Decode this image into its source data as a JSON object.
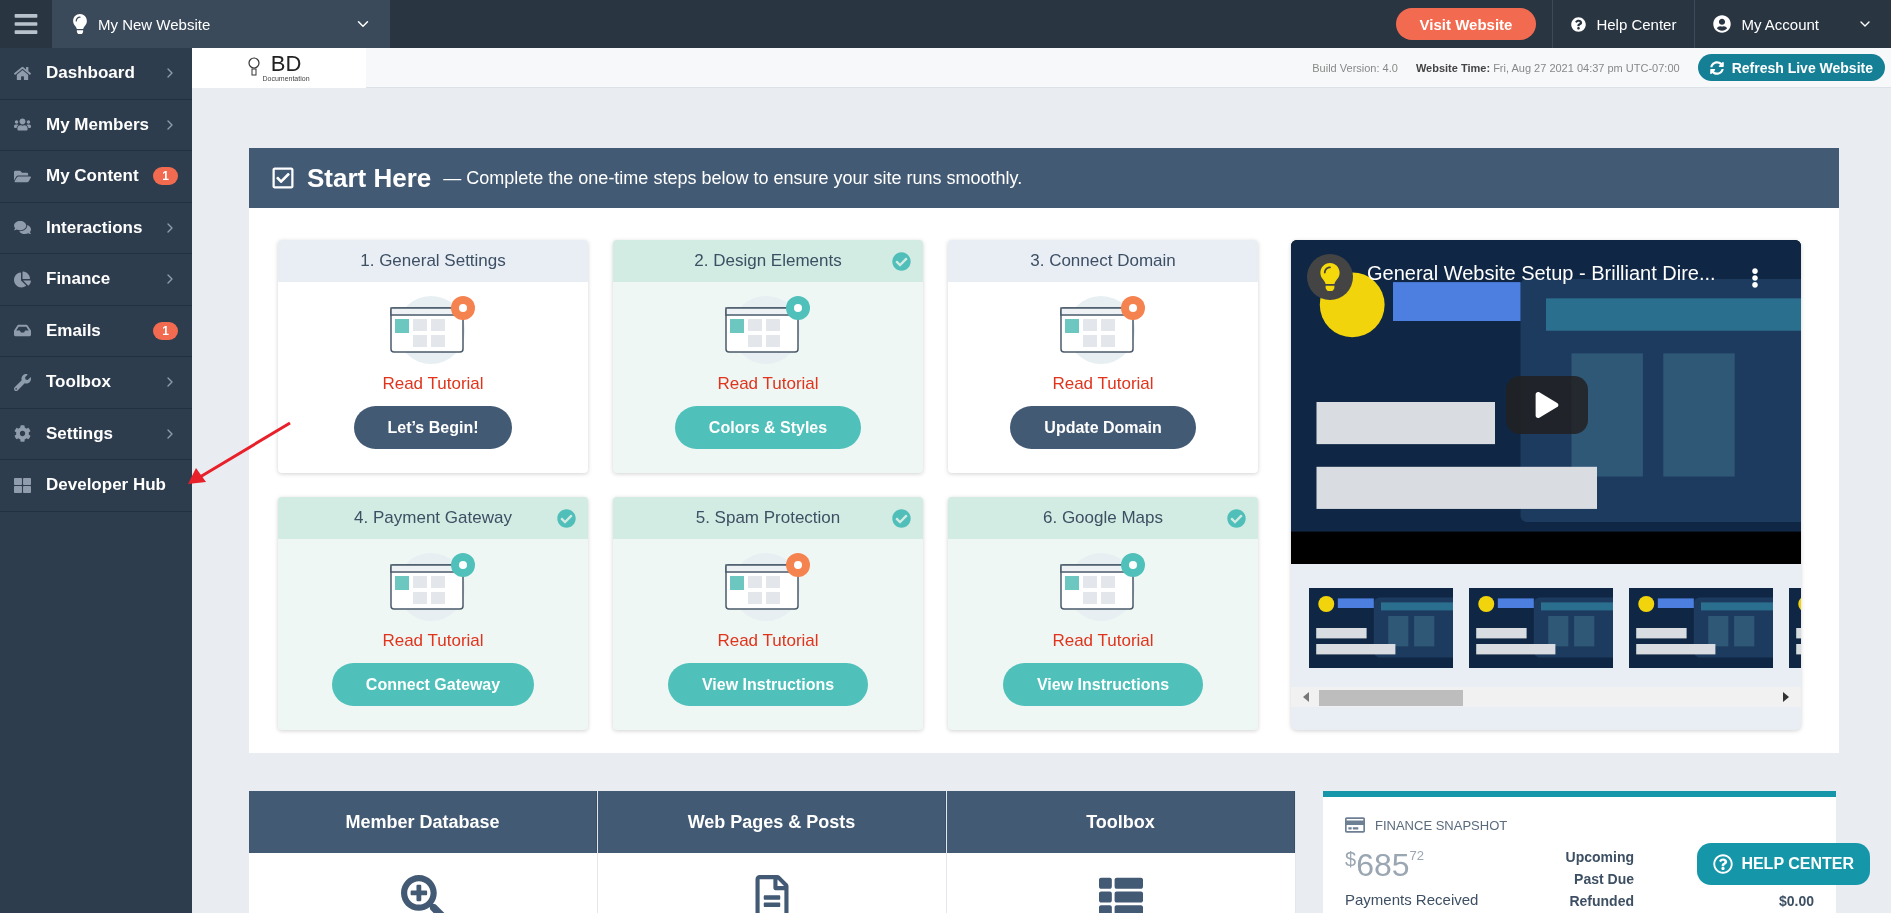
{
  "topbar": {
    "site": "My New Website",
    "visit_button": "Visit Website",
    "help": "Help Center",
    "account": "My Account"
  },
  "sidebar": {
    "items": [
      {
        "label": "Dashboard"
      },
      {
        "label": "My Members"
      },
      {
        "label": "My Content",
        "badge": "1"
      },
      {
        "label": "Interactions"
      },
      {
        "label": "Finance"
      },
      {
        "label": "Emails",
        "badge": "1"
      },
      {
        "label": "Toolbox"
      },
      {
        "label": "Settings"
      },
      {
        "label": "Developer Hub"
      }
    ]
  },
  "subheader": {
    "logo_mark": "BD",
    "logo_caption": "Documentation",
    "build": "Build Version: 4.0",
    "time": "**Website Time:** Fri, Aug 27 2021 04:37 pm UTC-07:00",
    "refresh_button": "Refresh Live Website"
  },
  "start_here": {
    "title": "Start Here",
    "subtitle": "— Complete the one-time steps below to ensure your site runs smoothly.",
    "steps": [
      {
        "title": "1. General Settings",
        "link": "Read Tutorial",
        "button": "Let’s Begin!",
        "done": false
      },
      {
        "title": "2. Design Elements",
        "link": "Read Tutorial",
        "button": "Colors & Styles",
        "done": true
      },
      {
        "title": "3. Connect Domain",
        "link": "Read Tutorial",
        "button": "Update Domain",
        "done": false
      },
      {
        "title": "4. Payment Gateway",
        "link": "Read Tutorial",
        "button": "Connect Gateway",
        "done": true
      },
      {
        "title": "5. Spam Protection",
        "link": "Read Tutorial",
        "button": "View Instructions",
        "done": true
      },
      {
        "title": "6. Google Maps",
        "link": "Read Tutorial",
        "button": "View Instructions",
        "done": true
      }
    ],
    "video": {
      "title": "General Website Setup - Brilliant Dire..."
    }
  },
  "tools": [
    {
      "label": "Member Database"
    },
    {
      "label": "Web Pages & Posts"
    },
    {
      "label": "Toolbox"
    }
  ],
  "finance": {
    "title": "FINANCE SNAPSHOT",
    "currency": "$",
    "amount": "685",
    "cents": "72",
    "amount_label": "Payments Received",
    "rows": [
      {
        "label": "Upcoming"
      },
      {
        "label": "Past Due"
      },
      {
        "label": "Refunded",
        "value": "$0.00"
      }
    ]
  },
  "help_button": "HELP CENTER"
}
